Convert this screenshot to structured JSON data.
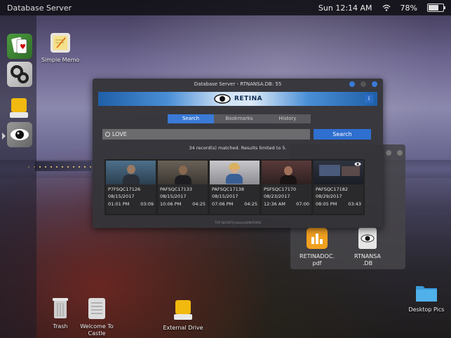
{
  "topbar": {
    "app_name": "Database Server",
    "datetime": "Sun 12:14 AM",
    "battery": "78%",
    "battery_level": 0.78
  },
  "desktop": {
    "simple_memo": "Simple Memo",
    "trash": "Trash",
    "welcome_line1": "Welcome To",
    "welcome_line2": "Castle",
    "external_drive": "External Drive",
    "desktop_pics": "Desktop Pics"
  },
  "back_window": {
    "files": [
      {
        "line1": "RETINADOC.",
        "line2": "pdf"
      },
      {
        "line1": "RTNANSA",
        "line2": ".DB"
      }
    ]
  },
  "window": {
    "title": "Database Server - RTNANSA.DB: 55",
    "brand": "RETINA",
    "info": "i",
    "tabs": [
      "Search",
      "Bookmarks",
      "History"
    ],
    "search_value": "LOVE",
    "search_button": "Search",
    "status": "34 record(s) matched. Results limited to 5.",
    "footer": "TOP SECRET/[redacted]/NOFORN",
    "records": [
      {
        "id": "P7FSQC17126",
        "date": "08/15/2017",
        "time": "01:01 PM",
        "duration": "03:09"
      },
      {
        "id": "PAFSQC17133",
        "date": "08/15/2017",
        "time": "10:06 PM",
        "duration": "04:25"
      },
      {
        "id": "PAFSQC17138",
        "date": "08/15/2017",
        "time": "07:06 PM",
        "duration": "04:25"
      },
      {
        "id": "PSFSQC17170",
        "date": "08/23/2017",
        "time": "12:36 AM",
        "duration": "07:00"
      },
      {
        "id": "PAFSQC17182",
        "date": "08/29/2017",
        "time": "08:05 PM",
        "duration": "03:43"
      }
    ]
  },
  "colors": {
    "accent": "#2f6fd0",
    "banner": "#1f5fa8",
    "folder": "#3a9ad9",
    "drive": "#f2b90f"
  }
}
